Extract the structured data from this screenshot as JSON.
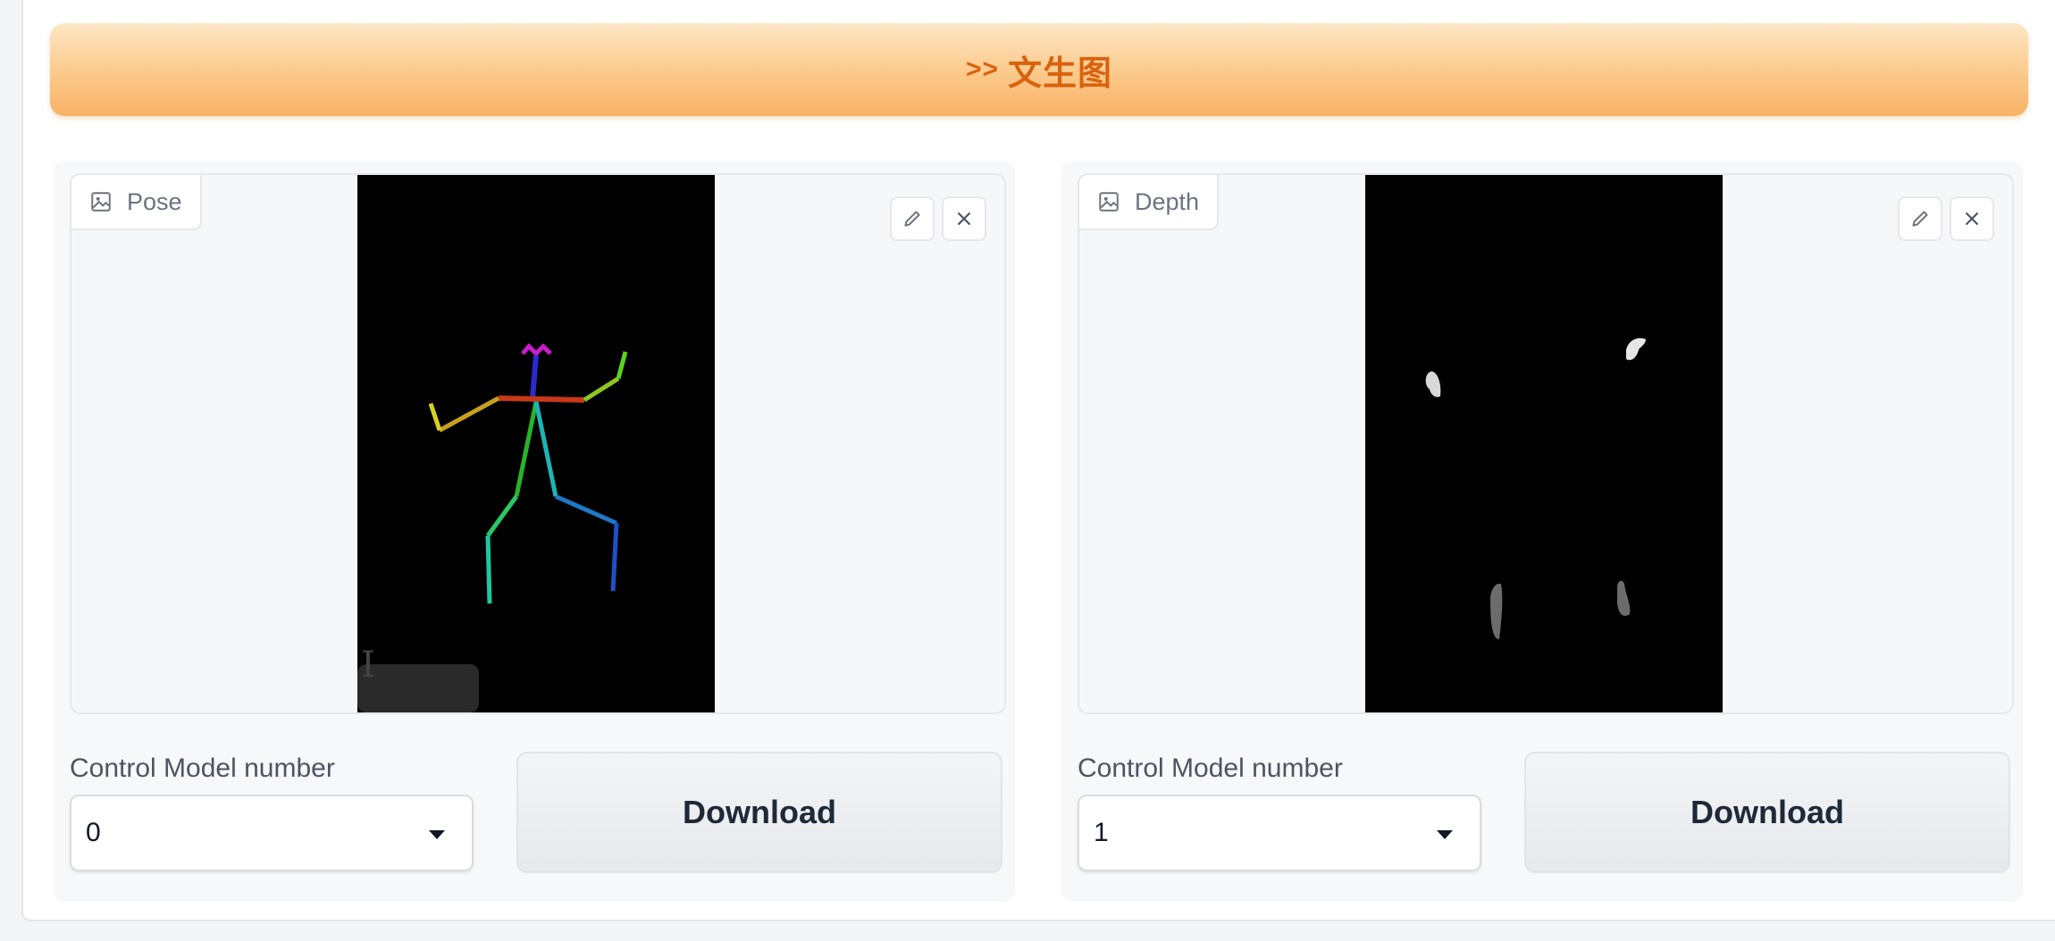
{
  "banner": {
    "arrows": ">>",
    "title": "文生图"
  },
  "panels": [
    {
      "image_label": "Pose",
      "control_label": "Control Model number",
      "selected_value": "0",
      "download_label": "Download"
    },
    {
      "image_label": "Depth",
      "control_label": "Control Model number",
      "selected_value": "1",
      "download_label": "Download"
    }
  ],
  "icons": {
    "image_tag": "image-icon",
    "edit": "pencil-icon",
    "clear": "close-icon",
    "dropdown": "chevron-down-icon"
  },
  "colors": {
    "banner_text": "#d9620e",
    "banner_gradient_top": "#fde7c6",
    "banner_gradient_bottom": "#f8b266"
  }
}
